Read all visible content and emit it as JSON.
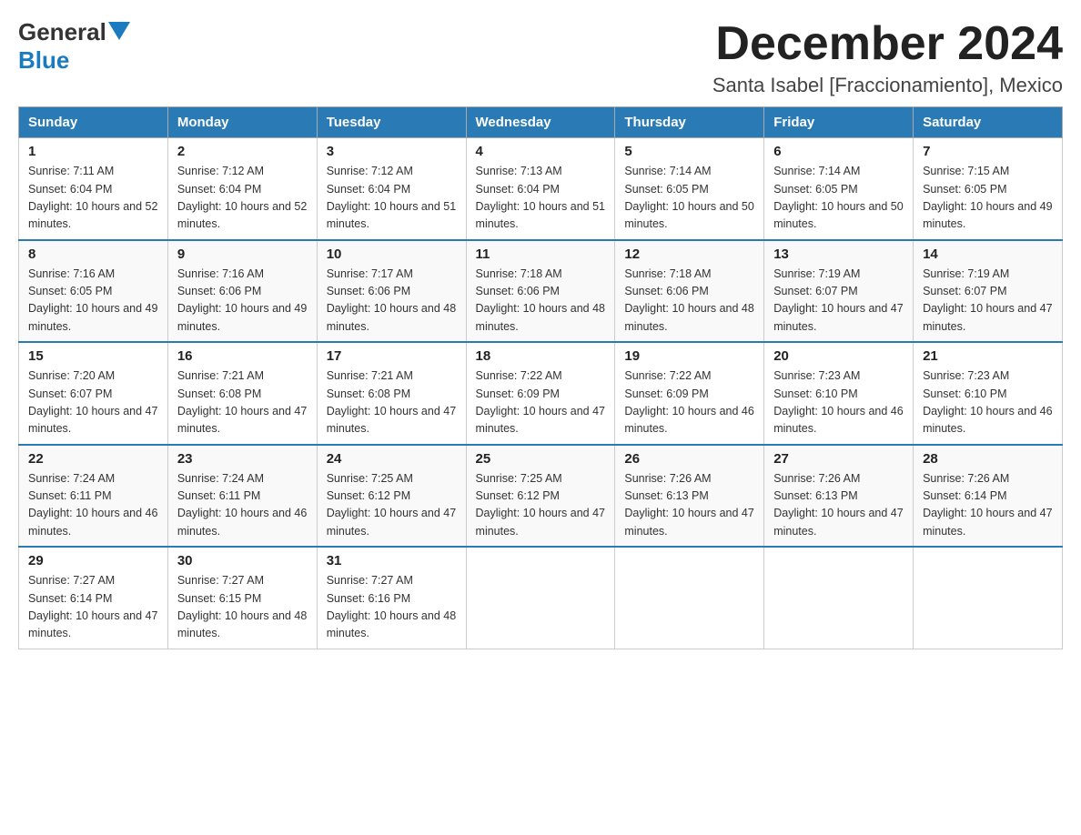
{
  "header": {
    "logo_general": "General",
    "logo_blue": "Blue",
    "title": "December 2024",
    "subtitle": "Santa Isabel [Fraccionamiento], Mexico"
  },
  "days_of_week": [
    "Sunday",
    "Monday",
    "Tuesday",
    "Wednesday",
    "Thursday",
    "Friday",
    "Saturday"
  ],
  "weeks": [
    [
      {
        "day": "1",
        "sunrise": "7:11 AM",
        "sunset": "6:04 PM",
        "daylight": "10 hours and 52 minutes."
      },
      {
        "day": "2",
        "sunrise": "7:12 AM",
        "sunset": "6:04 PM",
        "daylight": "10 hours and 52 minutes."
      },
      {
        "day": "3",
        "sunrise": "7:12 AM",
        "sunset": "6:04 PM",
        "daylight": "10 hours and 51 minutes."
      },
      {
        "day": "4",
        "sunrise": "7:13 AM",
        "sunset": "6:04 PM",
        "daylight": "10 hours and 51 minutes."
      },
      {
        "day": "5",
        "sunrise": "7:14 AM",
        "sunset": "6:05 PM",
        "daylight": "10 hours and 50 minutes."
      },
      {
        "day": "6",
        "sunrise": "7:14 AM",
        "sunset": "6:05 PM",
        "daylight": "10 hours and 50 minutes."
      },
      {
        "day": "7",
        "sunrise": "7:15 AM",
        "sunset": "6:05 PM",
        "daylight": "10 hours and 49 minutes."
      }
    ],
    [
      {
        "day": "8",
        "sunrise": "7:16 AM",
        "sunset": "6:05 PM",
        "daylight": "10 hours and 49 minutes."
      },
      {
        "day": "9",
        "sunrise": "7:16 AM",
        "sunset": "6:06 PM",
        "daylight": "10 hours and 49 minutes."
      },
      {
        "day": "10",
        "sunrise": "7:17 AM",
        "sunset": "6:06 PM",
        "daylight": "10 hours and 48 minutes."
      },
      {
        "day": "11",
        "sunrise": "7:18 AM",
        "sunset": "6:06 PM",
        "daylight": "10 hours and 48 minutes."
      },
      {
        "day": "12",
        "sunrise": "7:18 AM",
        "sunset": "6:06 PM",
        "daylight": "10 hours and 48 minutes."
      },
      {
        "day": "13",
        "sunrise": "7:19 AM",
        "sunset": "6:07 PM",
        "daylight": "10 hours and 47 minutes."
      },
      {
        "day": "14",
        "sunrise": "7:19 AM",
        "sunset": "6:07 PM",
        "daylight": "10 hours and 47 minutes."
      }
    ],
    [
      {
        "day": "15",
        "sunrise": "7:20 AM",
        "sunset": "6:07 PM",
        "daylight": "10 hours and 47 minutes."
      },
      {
        "day": "16",
        "sunrise": "7:21 AM",
        "sunset": "6:08 PM",
        "daylight": "10 hours and 47 minutes."
      },
      {
        "day": "17",
        "sunrise": "7:21 AM",
        "sunset": "6:08 PM",
        "daylight": "10 hours and 47 minutes."
      },
      {
        "day": "18",
        "sunrise": "7:22 AM",
        "sunset": "6:09 PM",
        "daylight": "10 hours and 47 minutes."
      },
      {
        "day": "19",
        "sunrise": "7:22 AM",
        "sunset": "6:09 PM",
        "daylight": "10 hours and 46 minutes."
      },
      {
        "day": "20",
        "sunrise": "7:23 AM",
        "sunset": "6:10 PM",
        "daylight": "10 hours and 46 minutes."
      },
      {
        "day": "21",
        "sunrise": "7:23 AM",
        "sunset": "6:10 PM",
        "daylight": "10 hours and 46 minutes."
      }
    ],
    [
      {
        "day": "22",
        "sunrise": "7:24 AM",
        "sunset": "6:11 PM",
        "daylight": "10 hours and 46 minutes."
      },
      {
        "day": "23",
        "sunrise": "7:24 AM",
        "sunset": "6:11 PM",
        "daylight": "10 hours and 46 minutes."
      },
      {
        "day": "24",
        "sunrise": "7:25 AM",
        "sunset": "6:12 PM",
        "daylight": "10 hours and 47 minutes."
      },
      {
        "day": "25",
        "sunrise": "7:25 AM",
        "sunset": "6:12 PM",
        "daylight": "10 hours and 47 minutes."
      },
      {
        "day": "26",
        "sunrise": "7:26 AM",
        "sunset": "6:13 PM",
        "daylight": "10 hours and 47 minutes."
      },
      {
        "day": "27",
        "sunrise": "7:26 AM",
        "sunset": "6:13 PM",
        "daylight": "10 hours and 47 minutes."
      },
      {
        "day": "28",
        "sunrise": "7:26 AM",
        "sunset": "6:14 PM",
        "daylight": "10 hours and 47 minutes."
      }
    ],
    [
      {
        "day": "29",
        "sunrise": "7:27 AM",
        "sunset": "6:14 PM",
        "daylight": "10 hours and 47 minutes."
      },
      {
        "day": "30",
        "sunrise": "7:27 AM",
        "sunset": "6:15 PM",
        "daylight": "10 hours and 48 minutes."
      },
      {
        "day": "31",
        "sunrise": "7:27 AM",
        "sunset": "6:16 PM",
        "daylight": "10 hours and 48 minutes."
      },
      null,
      null,
      null,
      null
    ]
  ]
}
